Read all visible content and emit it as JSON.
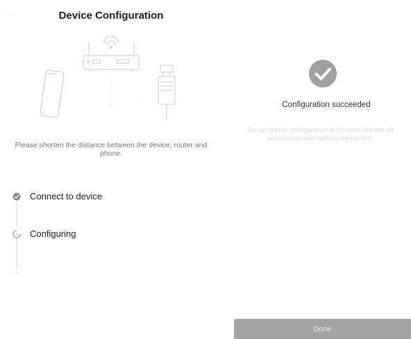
{
  "header": {
    "title": "Device Configuration"
  },
  "instructions": {
    "hint": "Please shorten the distance between the device, router and phone."
  },
  "steps": [
    {
      "label": "Connect to device",
      "state": "done"
    },
    {
      "label": "Configuring",
      "state": "in-progress"
    }
  ],
  "result": {
    "title": "Configuration succeeded",
    "description": "Set up default configuration in 10 mins. Monitor all accessories and options connected."
  },
  "actions": {
    "done_label": "Done"
  },
  "colors": {
    "success": "#a0a0a0",
    "button": "#a3a3a3",
    "line": "#c8c8c8"
  }
}
